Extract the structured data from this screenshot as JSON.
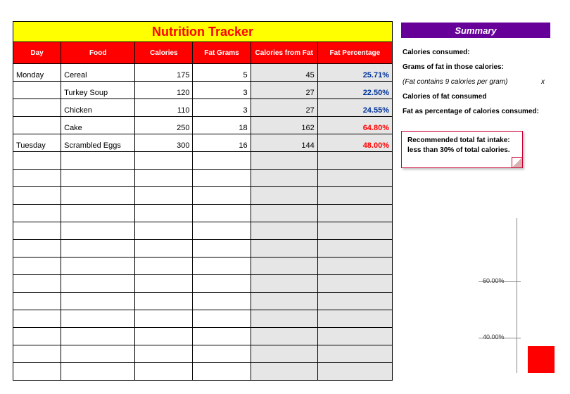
{
  "title": "Nutrition Tracker",
  "headers": {
    "day": "Day",
    "food": "Food",
    "calories": "Calories",
    "fat_grams": "Fat Grams",
    "cal_from_fat": "Calories from Fat",
    "fat_pct": "Fat Percentage"
  },
  "rows": [
    {
      "day": "Monday",
      "food": "Cereal",
      "calories": "175",
      "fat_grams": "5",
      "cff": "45",
      "pct": "25.71%",
      "pct_color": "blue"
    },
    {
      "day": "",
      "food": "Turkey Soup",
      "calories": "120",
      "fat_grams": "3",
      "cff": "27",
      "pct": "22.50%",
      "pct_color": "blue"
    },
    {
      "day": "",
      "food": "Chicken",
      "calories": "110",
      "fat_grams": "3",
      "cff": "27",
      "pct": "24.55%",
      "pct_color": "blue"
    },
    {
      "day": "",
      "food": "Cake",
      "calories": "250",
      "fat_grams": "18",
      "cff": "162",
      "pct": "64.80%",
      "pct_color": "red"
    },
    {
      "day": "Tuesday",
      "food": "Scrambled Eggs",
      "calories": "300",
      "fat_grams": "16",
      "cff": "144",
      "pct": "48.00%",
      "pct_color": "red"
    },
    {
      "day": "",
      "food": "",
      "calories": "",
      "fat_grams": "",
      "cff": "",
      "pct": ""
    },
    {
      "day": "",
      "food": "",
      "calories": "",
      "fat_grams": "",
      "cff": "",
      "pct": ""
    },
    {
      "day": "",
      "food": "",
      "calories": "",
      "fat_grams": "",
      "cff": "",
      "pct": ""
    },
    {
      "day": "",
      "food": "",
      "calories": "",
      "fat_grams": "",
      "cff": "",
      "pct": ""
    },
    {
      "day": "",
      "food": "",
      "calories": "",
      "fat_grams": "",
      "cff": "",
      "pct": ""
    },
    {
      "day": "",
      "food": "",
      "calories": "",
      "fat_grams": "",
      "cff": "",
      "pct": ""
    },
    {
      "day": "",
      "food": "",
      "calories": "",
      "fat_grams": "",
      "cff": "",
      "pct": ""
    },
    {
      "day": "",
      "food": "",
      "calories": "",
      "fat_grams": "",
      "cff": "",
      "pct": ""
    },
    {
      "day": "",
      "food": "",
      "calories": "",
      "fat_grams": "",
      "cff": "",
      "pct": ""
    },
    {
      "day": "",
      "food": "",
      "calories": "",
      "fat_grams": "",
      "cff": "",
      "pct": ""
    },
    {
      "day": "",
      "food": "",
      "calories": "",
      "fat_grams": "",
      "cff": "",
      "pct": ""
    },
    {
      "day": "",
      "food": "",
      "calories": "",
      "fat_grams": "",
      "cff": "",
      "pct": ""
    },
    {
      "day": "",
      "food": "",
      "calories": "",
      "fat_grams": "",
      "cff": "",
      "pct": ""
    }
  ],
  "summary": {
    "title": "Summary",
    "line1": "Calories consumed:",
    "line2": "Grams of fat in those calories:",
    "line3": "(Fat contains 9 calories per gram)",
    "line3x": "x",
    "line4": "Calories of fat consumed",
    "line5": "Fat as percentage of calories consumed:",
    "note": "Recommended total fat intake: less than 30% of total calories."
  },
  "chart_data": {
    "type": "bar",
    "ylabel": "",
    "ticks": {
      "t60": "60.00%",
      "t40": "40.00%"
    },
    "ylim": [
      0,
      100
    ]
  }
}
